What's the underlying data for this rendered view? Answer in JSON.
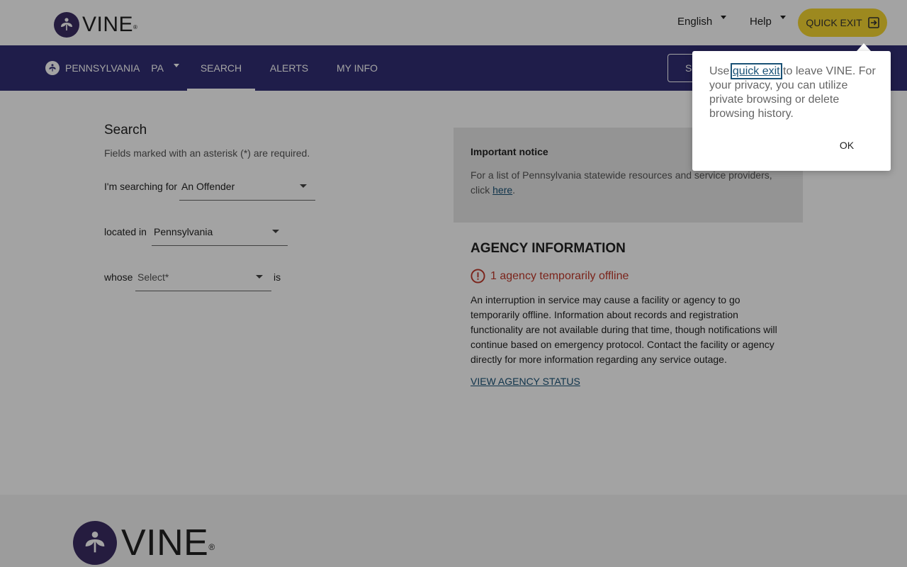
{
  "header": {
    "brand": "VINE",
    "brand_mark": "®",
    "language": "English",
    "help": "Help",
    "quick_exit": "QUICK EXIT",
    "quick_exit_icon": "exit-icon",
    "accent_color": "#f6d631"
  },
  "nav": {
    "state_name": "PENNSYLVANIA",
    "state_code": "PA",
    "tabs": [
      {
        "label": "SEARCH",
        "active": true
      },
      {
        "label": "ALERTS",
        "active": false
      },
      {
        "label": "MY INFO",
        "active": false
      }
    ],
    "button_label": "S",
    "bar_color": "#312e75"
  },
  "search": {
    "title": "Search",
    "required_note": "Fields marked with an asterisk (*) are required.",
    "searching_label": "I'm searching for",
    "searching_value": "An Offender",
    "located_label": "located in",
    "located_value": "Pennsylvania",
    "whose_label": "whose",
    "whose_placeholder": "Select*",
    "is_label": "is"
  },
  "notice": {
    "title": "Important notice",
    "body": "For a list of Pennsylvania statewide resources and service providers, click ",
    "link": "here",
    "end": "."
  },
  "agency": {
    "title": "AGENCY INFORMATION",
    "offline": "1 agency temporarily offline",
    "body": "An interruption in service may cause a facility or agency to go temporarily offline. Information about records and registration functionality are not available during that time, though notifications will continue based on emergency protocol. Contact the facility or agency directly for more information regarding any service outage.",
    "link": "VIEW AGENCY STATUS"
  },
  "popover": {
    "text_before": "Use ",
    "link": "quick exit",
    "text_after": " to leave VINE. For your privacy, you can utilize private browsing or delete browsing history.",
    "ok": "OK"
  },
  "footer": {
    "brand": "VINE",
    "brand_mark": "®"
  }
}
